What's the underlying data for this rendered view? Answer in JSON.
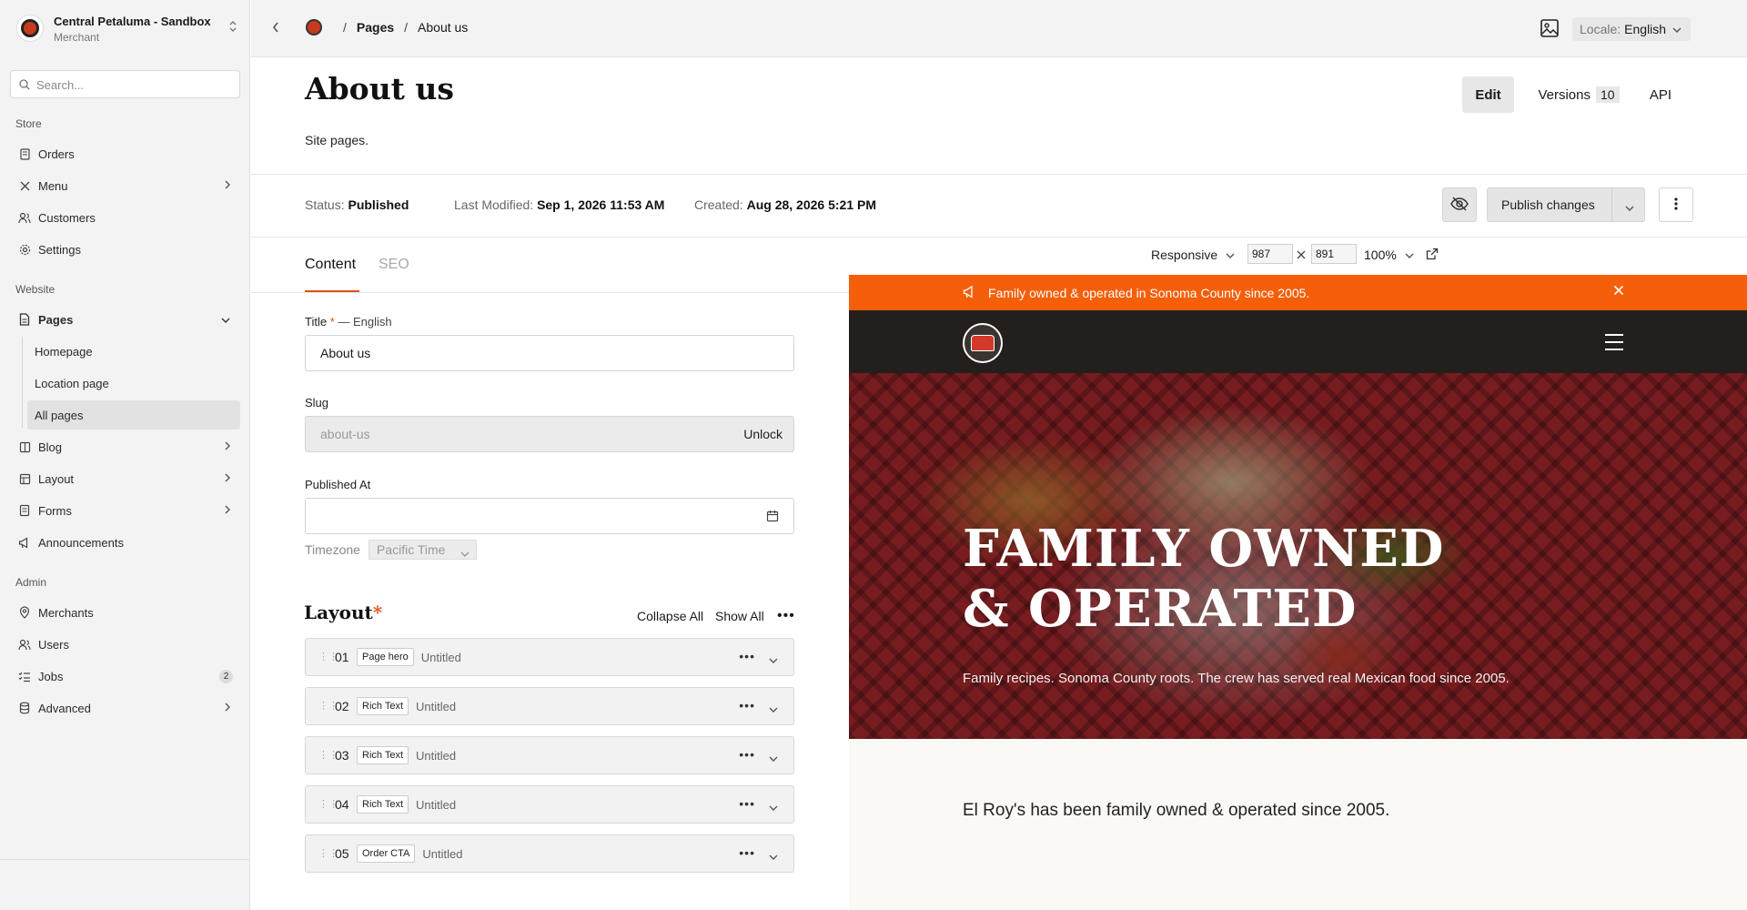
{
  "workspace": {
    "name": "Central Petaluma - Sandbox",
    "role": "Merchant"
  },
  "search": {
    "placeholder": "Search..."
  },
  "sidebar": {
    "store_label": "Store",
    "website_label": "Website",
    "admin_label": "Admin",
    "store_items": [
      "Orders",
      "Menu",
      "Customers",
      "Settings"
    ],
    "website_items": [
      "Pages",
      "Blog",
      "Layout",
      "Forms",
      "Announcements"
    ],
    "pages_sub": [
      "Homepage",
      "Location page",
      "All pages"
    ],
    "admin_items": [
      "Merchants",
      "Users",
      "Jobs",
      "Advanced"
    ],
    "jobs_badge": "2"
  },
  "breadcrumb": {
    "sep": "/",
    "section": "Pages",
    "current": "About us"
  },
  "locale": {
    "label": "Locale:",
    "value": "English"
  },
  "page": {
    "title": "About us",
    "description": "Site pages."
  },
  "header_tabs": {
    "edit": "Edit",
    "versions": "Versions",
    "versions_count": "10",
    "api": "API"
  },
  "status": {
    "status_label": "Status:",
    "status_value": "Published",
    "modified_label": "Last Modified:",
    "modified_value": "Sep 1, 2026 11:53 AM",
    "created_label": "Created:",
    "created_value": "Aug 28, 2026 5:21 PM"
  },
  "actions": {
    "publish": "Publish changes"
  },
  "tabs": {
    "content": "Content",
    "seo": "SEO"
  },
  "form": {
    "title_label": "Title",
    "title_required": "*",
    "title_locale": "— English",
    "title_value": "About us",
    "slug_label": "Slug",
    "slug_value": "about-us",
    "slug_unlock": "Unlock",
    "published_label": "Published At",
    "published_value": "",
    "timezone_label": "Timezone",
    "timezone_value": "Pacific Time"
  },
  "layout": {
    "title": "Layout",
    "required": "*",
    "collapse_all": "Collapse All",
    "show_all": "Show All",
    "blocks": [
      {
        "num": "01",
        "type": "Page hero",
        "title": "Untitled"
      },
      {
        "num": "02",
        "type": "Rich Text",
        "title": "Untitled"
      },
      {
        "num": "03",
        "type": "Rich Text",
        "title": "Untitled"
      },
      {
        "num": "04",
        "type": "Rich Text",
        "title": "Untitled"
      },
      {
        "num": "05",
        "type": "Order CTA",
        "title": "Untitled"
      }
    ]
  },
  "preview_toolbar": {
    "mode": "Responsive",
    "width": "987",
    "height": "891",
    "zoom": "100%"
  },
  "preview": {
    "announcement": "Family owned & operated in Sonoma County since 2005.",
    "hero_title_line1": "FAMILY OWNED",
    "hero_title_line2": "& OPERATED",
    "hero_subtitle": "Family recipes. Sonoma County roots. The crew has served real Mexican food since 2005.",
    "body": "El Roy's has been family owned & operated since 2005.",
    "colors": {
      "announcement_bg": "#f55f0a",
      "nav_bg": "#231f1d",
      "accent": "#e0531b"
    }
  }
}
